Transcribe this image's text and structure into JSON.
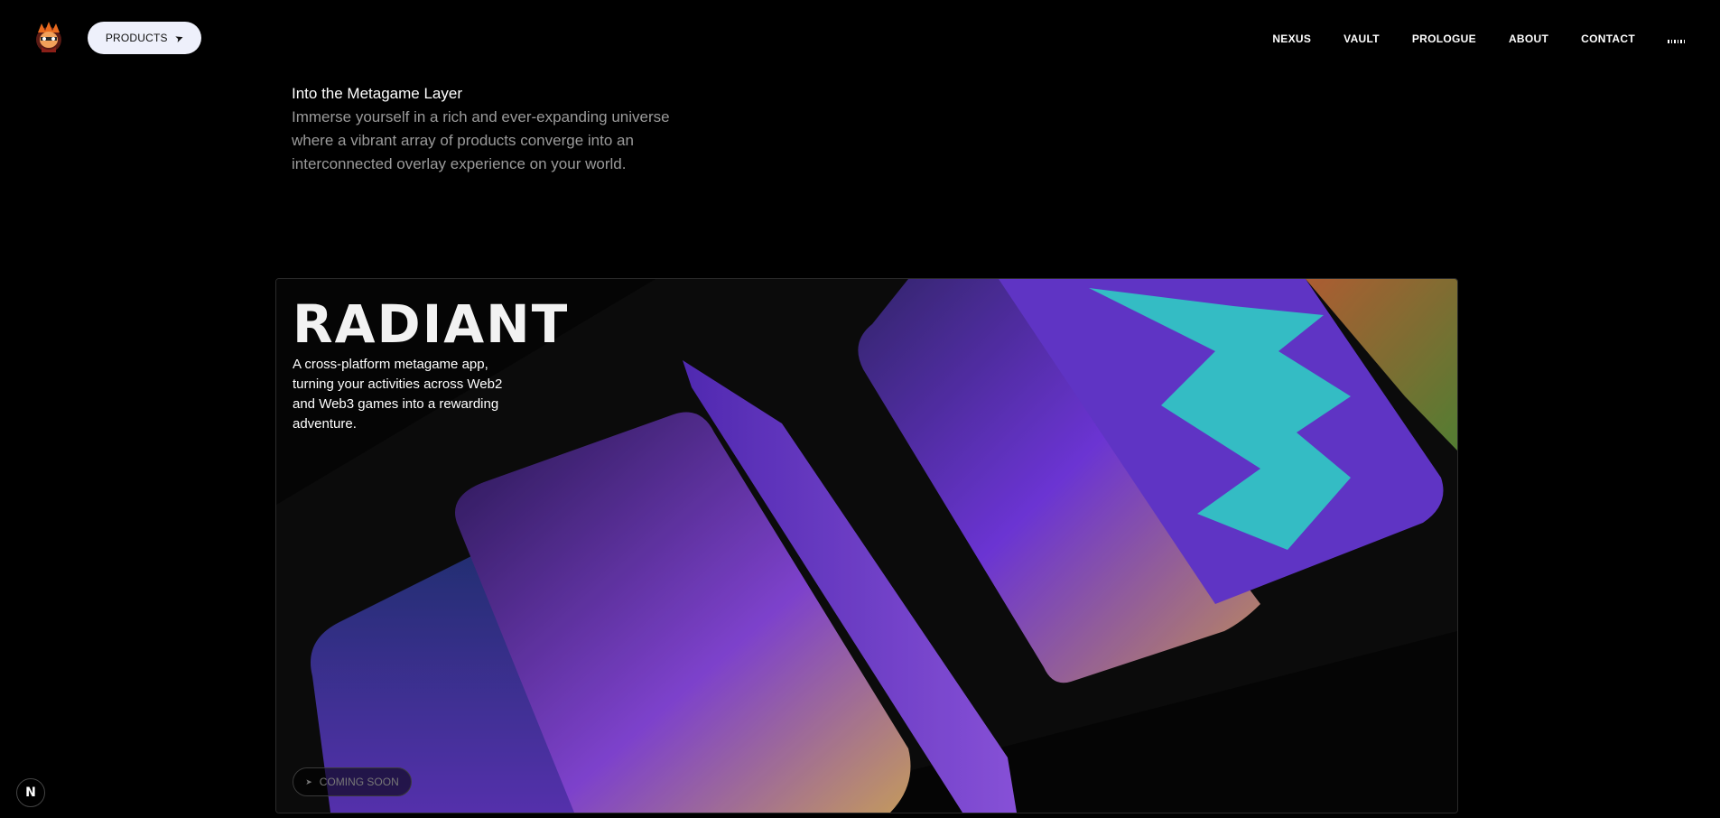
{
  "header": {
    "products_label": "PRODUCTS",
    "products_icon": "send-arrow-icon",
    "nav": [
      {
        "label": "NEXUS"
      },
      {
        "label": "VAULT"
      },
      {
        "label": "PROLOGUE"
      },
      {
        "label": "ABOUT"
      },
      {
        "label": "CONTACT"
      }
    ],
    "audio_icon": "audio-bars-icon"
  },
  "intro": {
    "title": "Into the Metagame Layer",
    "text": "Immerse yourself in a rich and ever-expanding universe where a vibrant array of products converge into an interconnected overlay experience on your world."
  },
  "card": {
    "title": "RADIANT",
    "description": "A cross-platform metagame app, turning your activities across Web2 and Web3 games into a rewarding adventure.",
    "cta_label": "COMING SOON",
    "cta_icon": "arrow-icon"
  },
  "badge": {
    "label": "N"
  },
  "colors": {
    "background": "#000000",
    "button_bg": "#eef0fb",
    "muted_text": "#9a9a9a",
    "purple": "#7a3cf0",
    "cyan": "#3cd6e0"
  }
}
